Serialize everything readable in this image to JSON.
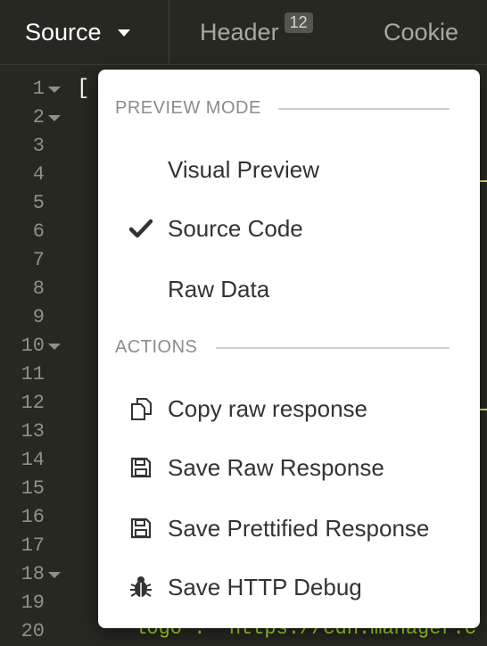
{
  "tabs": {
    "source_label": "Source",
    "header_label": "Header",
    "header_count": "12",
    "cookie_label": "Cookie"
  },
  "editor": {
    "line_numbers": [
      "1",
      "2",
      "3",
      "4",
      "5",
      "6",
      "7",
      "8",
      "9",
      "10",
      "11",
      "12",
      "13",
      "14",
      "15",
      "16",
      "17",
      "18",
      "19",
      "20"
    ],
    "first_line_text": "[",
    "partial_bottom_text": "\"logo\": \"https://cdn.manager.c"
  },
  "menu": {
    "preview_mode_header": "PREVIEW MODE",
    "visual_preview": "Visual Preview",
    "source_code": "Source Code",
    "raw_data": "Raw Data",
    "actions_header": "ACTIONS",
    "copy_raw_response": "Copy raw response",
    "save_raw_response": "Save Raw Response",
    "save_prettified_response": "Save Prettified Response",
    "save_http_debug": "Save HTTP Debug",
    "selected_mode": "Source Code"
  },
  "icons": {
    "source_selected": "checkmark-icon",
    "copy": "copy-icon",
    "save_raw": "floppy-disk-icon",
    "save_pretty": "floppy-disk-icon",
    "debug": "bug-icon"
  },
  "colors": {
    "editor_bg": "#272822",
    "menu_bg": "#ffffff",
    "gutter_text": "#8f908a",
    "string_yellow": "#e6db74",
    "string_green": "#a6e22e"
  }
}
